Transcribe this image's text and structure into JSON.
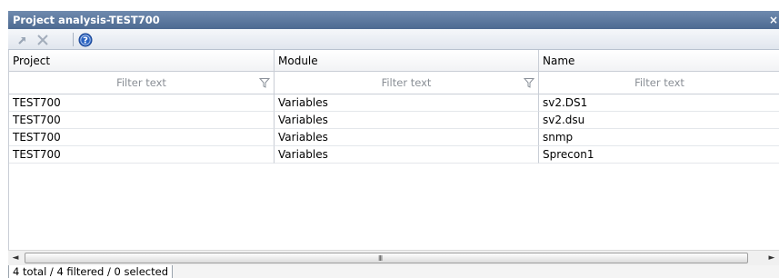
{
  "window": {
    "title": "Project analysis-TEST700",
    "close_glyph": "×"
  },
  "toolbar": {
    "items": [
      {
        "icon": "goto-arrow-icon"
      },
      {
        "icon": "delete-x-icon"
      },
      {
        "icon": "help-icon"
      }
    ]
  },
  "table": {
    "columns": [
      {
        "label": "Project"
      },
      {
        "label": "Module"
      },
      {
        "label": "Name"
      }
    ],
    "filter_placeholder": "Filter text",
    "rows": [
      [
        "TEST700",
        "Variables",
        "sv2.DS1"
      ],
      [
        "TEST700",
        "Variables",
        "sv2.dsu"
      ],
      [
        "TEST700",
        "Variables",
        "snmp"
      ],
      [
        "TEST700",
        "Variables",
        "Sprecon1"
      ]
    ]
  },
  "scrollbar": {
    "left_arrow": "◄",
    "right_arrow": "►",
    "grip": "III"
  },
  "status": {
    "text": "4 total / 4 filtered / 0 selected"
  },
  "colors": {
    "titlebar": "#5a769b",
    "accent_help": "#2a63c2"
  }
}
